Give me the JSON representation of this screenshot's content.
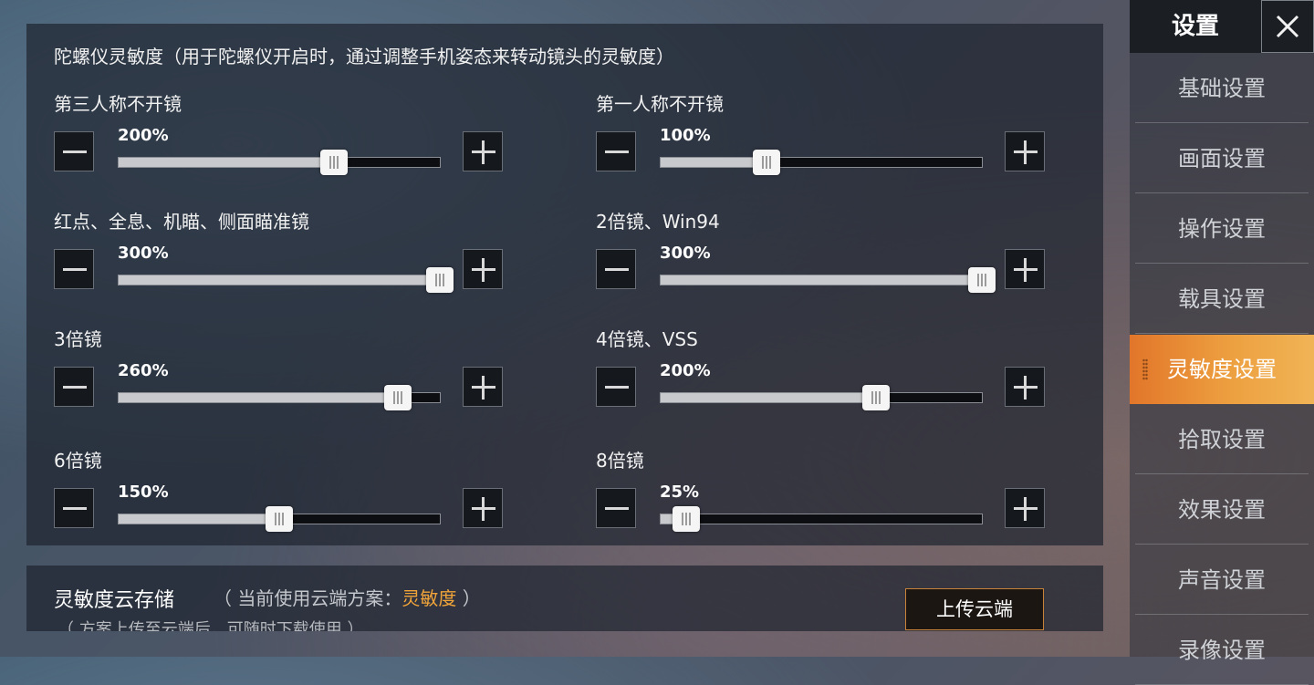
{
  "panel": {
    "title": "陀螺仪灵敏度（用于陀螺仪开启时，通过调整手机姿态来转动镜头的灵敏度）"
  },
  "settings": [
    {
      "label": "第三人称不开镜",
      "value": "200%",
      "fraction": 0.67
    },
    {
      "label": "第一人称不开镜",
      "value": "100%",
      "fraction": 0.33
    },
    {
      "label": "红点、全息、机瞄、侧面瞄准镜",
      "value": "300%",
      "fraction": 1.0
    },
    {
      "label": "2倍镜、Win94",
      "value": "300%",
      "fraction": 1.0
    },
    {
      "label": "3倍镜",
      "value": "260%",
      "fraction": 0.87
    },
    {
      "label": "4倍镜、VSS",
      "value": "200%",
      "fraction": 0.67
    },
    {
      "label": "6倍镜",
      "value": "150%",
      "fraction": 0.5
    },
    {
      "label": "8倍镜",
      "value": "25%",
      "fraction": 0.08
    }
  ],
  "cloud": {
    "title": "灵敏度云存储",
    "sub_prefix": "（ 当前使用云端方案：",
    "sub_highlight": "灵敏度",
    "sub_suffix": " ）",
    "desc": "（ 方案上传至云端后，可随时下载使用 ）",
    "upload_label": "上传云端"
  },
  "sidebar": {
    "title": "设置",
    "items": [
      {
        "label": "基础设置"
      },
      {
        "label": "画面设置"
      },
      {
        "label": "操作设置"
      },
      {
        "label": "载具设置"
      },
      {
        "label": "灵敏度设置",
        "active": true
      },
      {
        "label": "拾取设置"
      },
      {
        "label": "效果设置"
      },
      {
        "label": "声音设置"
      },
      {
        "label": "录像设置"
      }
    ]
  },
  "colors": {
    "accent": "#ee9a3c",
    "highlight_text": "#f0a43a"
  }
}
